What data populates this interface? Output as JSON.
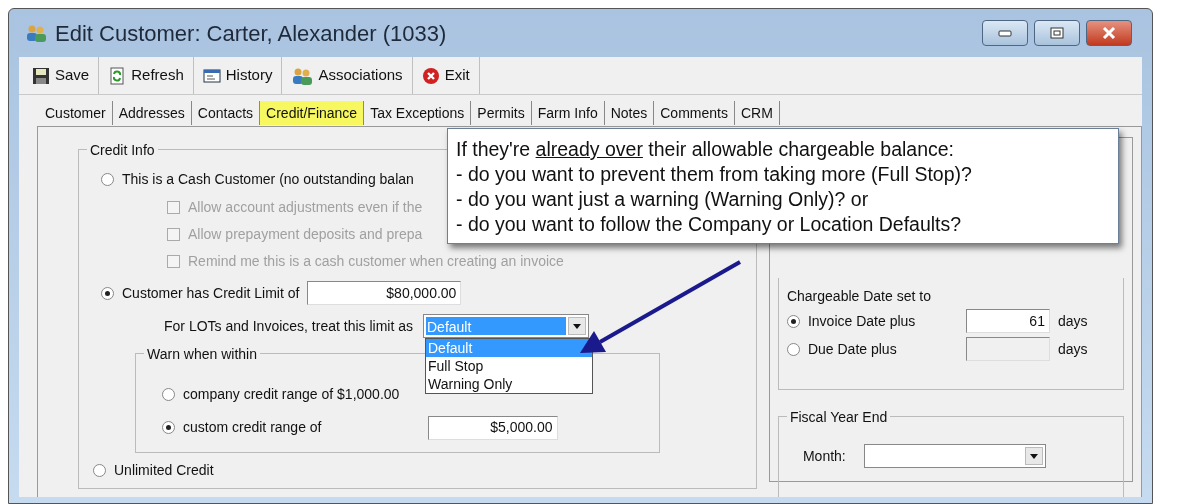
{
  "window": {
    "title": "Edit Customer: Carter, Alexander (1033)"
  },
  "toolbar": [
    {
      "label": "Save",
      "kind": "save"
    },
    {
      "label": "Refresh",
      "kind": "refresh"
    },
    {
      "label": "History",
      "kind": "history"
    },
    {
      "label": "Associations",
      "kind": "associations"
    },
    {
      "label": "Exit",
      "kind": "exit"
    }
  ],
  "tabs": [
    {
      "label": "Customer",
      "selected": false
    },
    {
      "label": "Addresses",
      "selected": false
    },
    {
      "label": "Contacts",
      "selected": false
    },
    {
      "label": "Credit/Finance",
      "selected": true
    },
    {
      "label": "Tax Exceptions",
      "selected": false
    },
    {
      "label": "Permits",
      "selected": false
    },
    {
      "label": "Farm Info",
      "selected": false
    },
    {
      "label": "Notes",
      "selected": false
    },
    {
      "label": "Comments",
      "selected": false
    },
    {
      "label": "CRM",
      "selected": false
    }
  ],
  "credit_info": {
    "title": "Credit Info",
    "cash_option": {
      "label": "This is a Cash Customer (no outstanding balan",
      "selected": false
    },
    "cash_settings": [
      {
        "label": "Allow account adjustments even if the",
        "checked": false,
        "disabled": true
      },
      {
        "label": "Allow prepayment deposits and prepa",
        "checked": false,
        "disabled": true
      },
      {
        "label": "Remind me this is a cash customer when creating an invoice",
        "checked": false,
        "disabled": true
      }
    ],
    "limit_option": {
      "label": "Customer has Credit Limit of",
      "selected": true,
      "value": "$80,000.00"
    },
    "treat_limit": {
      "label": "For LOTs and Invoices, treat this limit as",
      "value": "Default",
      "expanded": true,
      "options": [
        {
          "label": "Default",
          "selected": true
        },
        {
          "label": "Full Stop",
          "selected": false
        },
        {
          "label": "Warning Only",
          "selected": false
        }
      ]
    },
    "warn": {
      "title": "Warn when within",
      "options": [
        {
          "label": "company credit range of $1,000.00",
          "selected": false
        },
        {
          "label": "custom credit range of",
          "selected": true,
          "value": "$5,000.00"
        }
      ]
    },
    "unlimited_option": {
      "label": "Unlimited Credit",
      "selected": false
    }
  },
  "chargeable_date": {
    "title": "Chargeable Date set to",
    "options": [
      {
        "label": "Invoice Date plus",
        "selected": true,
        "value": "61",
        "unit": "days"
      },
      {
        "label": "Due Date plus",
        "selected": false,
        "unit": "days"
      }
    ]
  },
  "fiscal_year_end": {
    "title": "Fiscal Year End",
    "month_label": "Month:"
  },
  "callout": {
    "text_before": "If they're ",
    "underlined": "already over",
    "text_after": " their allowable chargeable balance:",
    "questions": [
      "- do you want to prevent them from taking more (Full Stop)?",
      "- do you want just a warning (Warning Only)? or",
      "- do you want to follow the Company or Location Defaults?"
    ]
  }
}
